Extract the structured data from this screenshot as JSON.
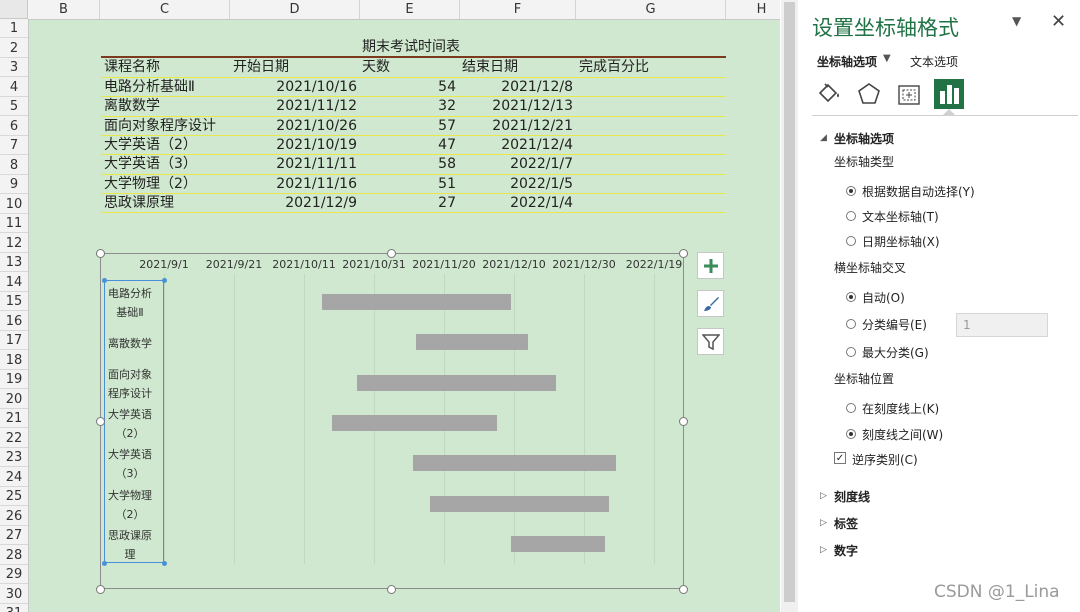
{
  "columns": [
    "B",
    "C",
    "D",
    "E",
    "F",
    "G",
    "H"
  ],
  "rows": [
    "1",
    "2",
    "3",
    "4",
    "5",
    "6",
    "7",
    "8",
    "9",
    "10",
    "11",
    "12",
    "13",
    "14",
    "15",
    "16",
    "17",
    "18",
    "19",
    "20",
    "21",
    "22",
    "23",
    "24",
    "25",
    "26",
    "27",
    "28",
    "29",
    "30",
    "31"
  ],
  "table": {
    "title": "期末考试时间表",
    "headers": [
      "课程名称",
      "开始日期",
      "天数",
      "结束日期",
      "完成百分比"
    ],
    "rows": [
      [
        "电路分析基础Ⅱ",
        "2021/10/16",
        "54",
        "2021/12/8"
      ],
      [
        "离散数学",
        "2021/11/12",
        "32",
        "2021/12/13"
      ],
      [
        "面向对象程序设计",
        "2021/10/26",
        "57",
        "2021/12/21"
      ],
      [
        "大学英语（2）",
        "2021/10/19",
        "47",
        "2021/12/4"
      ],
      [
        "大学英语（3）",
        "2021/11/11",
        "58",
        "2022/1/7"
      ],
      [
        "大学物理（2）",
        "2021/11/16",
        "51",
        "2022/1/5"
      ],
      [
        "思政课原理",
        "2021/12/9",
        "27",
        "2022/1/4"
      ]
    ]
  },
  "chart_data": {
    "type": "bar",
    "orientation": "horizontal-gantt",
    "x_tick_labels": [
      "2021/9/1",
      "2021/9/21",
      "2021/10/11",
      "2021/10/31",
      "2021/11/20",
      "2021/12/10",
      "2021/12/30",
      "2022/1/19"
    ],
    "categories": [
      [
        "电路分析",
        "基础Ⅱ"
      ],
      [
        "离散数学"
      ],
      [
        "面向对象",
        "程序设计"
      ],
      [
        "大学英语",
        "（2）"
      ],
      [
        "大学英语",
        "（3）"
      ],
      [
        "大学物理",
        "（2）"
      ],
      [
        "思政课原",
        "理"
      ]
    ],
    "series": [
      {
        "starts": [
          "2021/10/16",
          "2021/11/12",
          "2021/10/26",
          "2021/10/19",
          "2021/11/11",
          "2021/11/16",
          "2021/12/9"
        ],
        "values": [
          54,
          32,
          57,
          47,
          58,
          51,
          27
        ]
      }
    ],
    "bar_color": "#a6a6a6",
    "gridlines": true,
    "reverse_categories": true
  },
  "pane": {
    "title": "设置坐标轴格式",
    "tab_axis": "坐标轴选项",
    "tab_text": "文本选项",
    "section_axis_options": "坐标轴选项",
    "axis_type_label": "坐标轴类型",
    "axis_type_options": [
      "根据数据自动选择(Y)",
      "文本坐标轴(T)",
      "日期坐标轴(X)"
    ],
    "cross_label": "横坐标轴交叉",
    "cross_options": [
      "自动(O)",
      "分类编号(E)",
      "最大分类(G)"
    ],
    "cross_value": "1",
    "position_label": "坐标轴位置",
    "position_options": [
      "在刻度线上(K)",
      "刻度线之间(W)"
    ],
    "reverse_label": "逆序类别(C)",
    "sec_ticks": "刻度线",
    "sec_labels": "标签",
    "sec_number": "数字"
  },
  "watermark": "CSDN @1_Lina"
}
